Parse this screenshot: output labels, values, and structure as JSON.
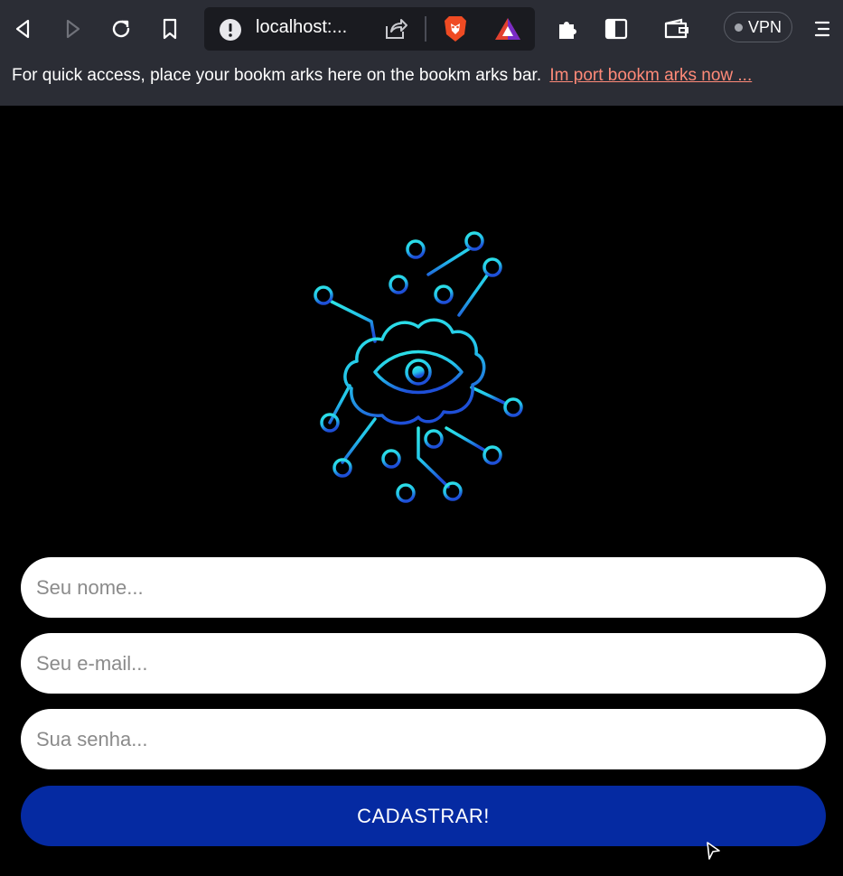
{
  "browser": {
    "url_text": "localhost:...",
    "vpn_label": "VPN",
    "bookmarks_message": "For quick access, place your bookm arks here on the bookm arks bar.",
    "bookmarks_import_link": "Im port bookm arks now ..."
  },
  "icons": {
    "back": "back-arrow-icon",
    "forward": "forward-arrow-icon",
    "reload": "reload-icon",
    "bookmark": "bookmark-icon",
    "site_info": "site-info-icon",
    "share": "share-icon",
    "brave": "brave-shields-icon",
    "rewards": "brave-rewards-icon",
    "extensions": "puzzle-icon",
    "sidebar": "sidebar-icon",
    "wallet": "wallet-icon",
    "menu": "hamburger-menu-icon",
    "logo": "circuit-cloud-eye-icon"
  },
  "form": {
    "name_placeholder": "Seu nome...",
    "email_placeholder": "Seu e-mail...",
    "password_placeholder": "Sua senha...",
    "submit_label": "CADASTRAR!"
  },
  "colors": {
    "page_background": "#000000",
    "browser_chrome": "#2b2d35",
    "submit_button": "#052aa2",
    "link": "#ff8a78",
    "logo_cyan": "#2ee6e6",
    "logo_blue": "#1e4fd8"
  }
}
